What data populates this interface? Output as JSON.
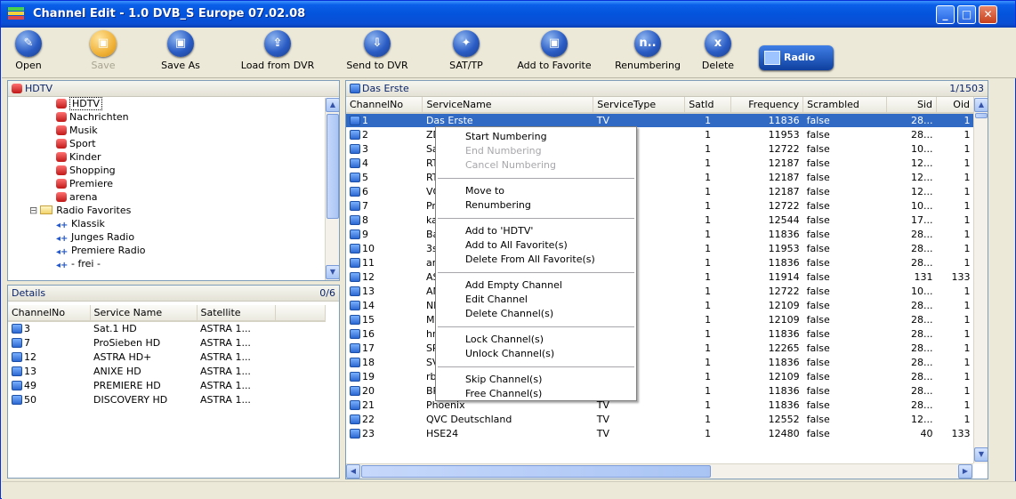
{
  "window": {
    "title": "Channel Edit - 1.0 DVB_S Europe 07.02.08"
  },
  "toolbar": {
    "buttons": [
      {
        "label": "Open",
        "glyph": "✎"
      },
      {
        "label": "Save",
        "glyph": "▣"
      },
      {
        "label": "Save As",
        "glyph": "▣"
      },
      {
        "label": "Load from DVR",
        "glyph": "⇪"
      },
      {
        "label": "Send to DVR",
        "glyph": "⇩"
      },
      {
        "label": "SAT/TP",
        "glyph": "✦"
      },
      {
        "label": "Add to Favorite",
        "glyph": "▣"
      },
      {
        "label": "Renumbering",
        "glyph": "n.."
      },
      {
        "label": "Delete",
        "glyph": "x"
      }
    ],
    "radio_label": "Radio"
  },
  "tree": {
    "header": "HDTV",
    "items": [
      {
        "label": "HDTV",
        "type": "fav",
        "indent": 1
      },
      {
        "label": "Nachrichten",
        "type": "fav",
        "indent": 1
      },
      {
        "label": "Musik",
        "type": "fav",
        "indent": 1
      },
      {
        "label": "Sport",
        "type": "fav",
        "indent": 1
      },
      {
        "label": "Kinder",
        "type": "fav",
        "indent": 1
      },
      {
        "label": "Shopping",
        "type": "fav",
        "indent": 1
      },
      {
        "label": "Premiere",
        "type": "fav",
        "indent": 1
      },
      {
        "label": "arena",
        "type": "fav",
        "indent": 1
      },
      {
        "label": "Radio Favorites",
        "type": "folder",
        "indent": 0
      },
      {
        "label": "Klassik",
        "type": "radio",
        "indent": 1
      },
      {
        "label": "Junges Radio",
        "type": "radio",
        "indent": 1
      },
      {
        "label": "Premiere Radio",
        "type": "radio",
        "indent": 1
      },
      {
        "label": "- frei -",
        "type": "radio",
        "indent": 1
      }
    ]
  },
  "details": {
    "header": "Details",
    "count": "0/6",
    "columns": [
      "ChannelNo",
      "Service Name",
      "Satellite"
    ],
    "rows": [
      [
        "3",
        "Sat.1 HD",
        "ASTRA 1..."
      ],
      [
        "7",
        "ProSieben HD",
        "ASTRA 1..."
      ],
      [
        "12",
        "ASTRA HD+",
        "ASTRA 1..."
      ],
      [
        "13",
        "ANIXE HD",
        "ASTRA 1..."
      ],
      [
        "49",
        "PREMIERE HD",
        "ASTRA 1..."
      ],
      [
        "50",
        "DISCOVERY HD",
        "ASTRA 1..."
      ]
    ]
  },
  "channels": {
    "header": "Das Erste",
    "count": "1/1503",
    "columns": [
      "ChannelNo",
      "ServiceName",
      "ServiceType",
      "SatId",
      "Frequency",
      "Scrambled",
      "Sid",
      "Oid"
    ],
    "rows": [
      [
        "1",
        "Das Erste",
        "TV",
        "1",
        "11836",
        "false",
        "28...",
        "1"
      ],
      [
        "2",
        "ZD",
        "",
        "1",
        "11953",
        "false",
        "28...",
        "1"
      ],
      [
        "3",
        "Sa",
        "",
        "1",
        "12722",
        "false",
        "10...",
        "1"
      ],
      [
        "4",
        "RT",
        "",
        "1",
        "12187",
        "false",
        "12...",
        "1"
      ],
      [
        "5",
        "RT",
        "",
        "1",
        "12187",
        "false",
        "12...",
        "1"
      ],
      [
        "6",
        "VC",
        "",
        "1",
        "12187",
        "false",
        "12...",
        "1"
      ],
      [
        "7",
        "Pr",
        "",
        "1",
        "12722",
        "false",
        "10...",
        "1"
      ],
      [
        "8",
        "ka",
        "",
        "1",
        "12544",
        "false",
        "17...",
        "1"
      ],
      [
        "9",
        "Ba",
        "",
        "1",
        "11836",
        "false",
        "28...",
        "1"
      ],
      [
        "10",
        "3s",
        "",
        "1",
        "11953",
        "false",
        "28...",
        "1"
      ],
      [
        "11",
        "ar",
        "",
        "1",
        "11836",
        "false",
        "28...",
        "1"
      ],
      [
        "12",
        "AS",
        "",
        "1",
        "11914",
        "false",
        "131",
        "133"
      ],
      [
        "13",
        "AN",
        "",
        "1",
        "12722",
        "false",
        "10...",
        "1"
      ],
      [
        "14",
        "ND",
        "",
        "1",
        "12109",
        "false",
        "28...",
        "1"
      ],
      [
        "15",
        "MD",
        "",
        "1",
        "12109",
        "false",
        "28...",
        "1"
      ],
      [
        "16",
        "hr",
        "",
        "1",
        "11836",
        "false",
        "28...",
        "1"
      ],
      [
        "17",
        "SR",
        "",
        "1",
        "12265",
        "false",
        "28...",
        "1"
      ],
      [
        "18",
        "SV",
        "",
        "1",
        "11836",
        "false",
        "28...",
        "1"
      ],
      [
        "19",
        "rb",
        "",
        "1",
        "12109",
        "false",
        "28...",
        "1"
      ],
      [
        "20",
        "BR-alpha",
        "TV",
        "1",
        "11836",
        "false",
        "28...",
        "1"
      ],
      [
        "21",
        "Phoenix",
        "TV",
        "1",
        "11836",
        "false",
        "28...",
        "1"
      ],
      [
        "22",
        "QVC Deutschland",
        "TV",
        "1",
        "12552",
        "false",
        "12...",
        "1"
      ],
      [
        "23",
        "HSE24",
        "TV",
        "1",
        "12480",
        "false",
        "40",
        "133"
      ]
    ]
  },
  "context_menu": {
    "items": [
      {
        "label": "Start Numbering",
        "disabled": false
      },
      {
        "label": "End Numbering",
        "disabled": true
      },
      {
        "label": "Cancel Numbering",
        "disabled": true
      },
      {
        "sep": true
      },
      {
        "label": "Move to",
        "disabled": false
      },
      {
        "label": "Renumbering",
        "disabled": false
      },
      {
        "sep": true
      },
      {
        "label": "Add to 'HDTV'",
        "disabled": false
      },
      {
        "label": "Add to All Favorite(s)",
        "disabled": false
      },
      {
        "label": "Delete From All Favorite(s)",
        "disabled": false
      },
      {
        "sep": true
      },
      {
        "label": "Add Empty Channel",
        "disabled": false
      },
      {
        "label": "Edit Channel",
        "disabled": false
      },
      {
        "label": "Delete Channel(s)",
        "disabled": false
      },
      {
        "sep": true
      },
      {
        "label": "Lock Channel(s)",
        "disabled": false
      },
      {
        "label": "Unlock Channel(s)",
        "disabled": false
      },
      {
        "sep": true
      },
      {
        "label": "Skip Channel(s)",
        "disabled": false
      },
      {
        "label": "Free Channel(s)",
        "disabled": false
      }
    ]
  }
}
